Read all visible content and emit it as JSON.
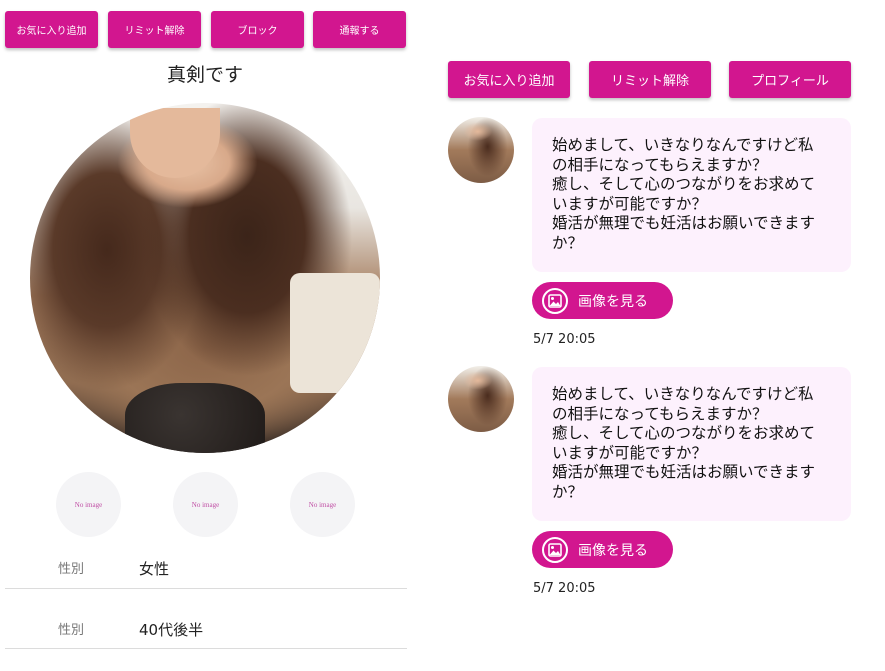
{
  "left_panel": {
    "buttons": {
      "favorite": "お気に入り追加",
      "unlimit": "リミット解除",
      "block": "ブロック",
      "report": "通報する"
    },
    "profile_title": "真剣です",
    "thumbnails": [
      "No image",
      "No image",
      "No image"
    ],
    "info": [
      {
        "label": "性別",
        "value": "女性"
      },
      {
        "label": "性別",
        "value": "40代後半"
      }
    ]
  },
  "right_panel": {
    "buttons": {
      "favorite": "お気に入り追加",
      "unlimit": "リミット解除",
      "profile": "プロフィール"
    },
    "messages": [
      {
        "text": "始めまして、いきなりなんですけど私\nの相手になってもらえますか？\n癒し、そして心のつながりをお求めて\nいますが可能ですか？\n婚活が無理でも妊活はお願いできます\nか？",
        "image_button": "画像を見る",
        "time": "5/7 20:05"
      },
      {
        "text": "始めまして、いきなりなんですけど私\nの相手になってもらえますか？\n癒し、そして心のつながりをお求めて\nいますが可能ですか？\n婚活が無理でも妊活はお願いできます\nか？",
        "image_button": "画像を見る",
        "time": "5/7 20:05"
      }
    ]
  },
  "colors": {
    "accent": "#d2168f",
    "bubble": "#fdf1fd"
  },
  "icons": {
    "image_button_icon": "image-icon"
  }
}
